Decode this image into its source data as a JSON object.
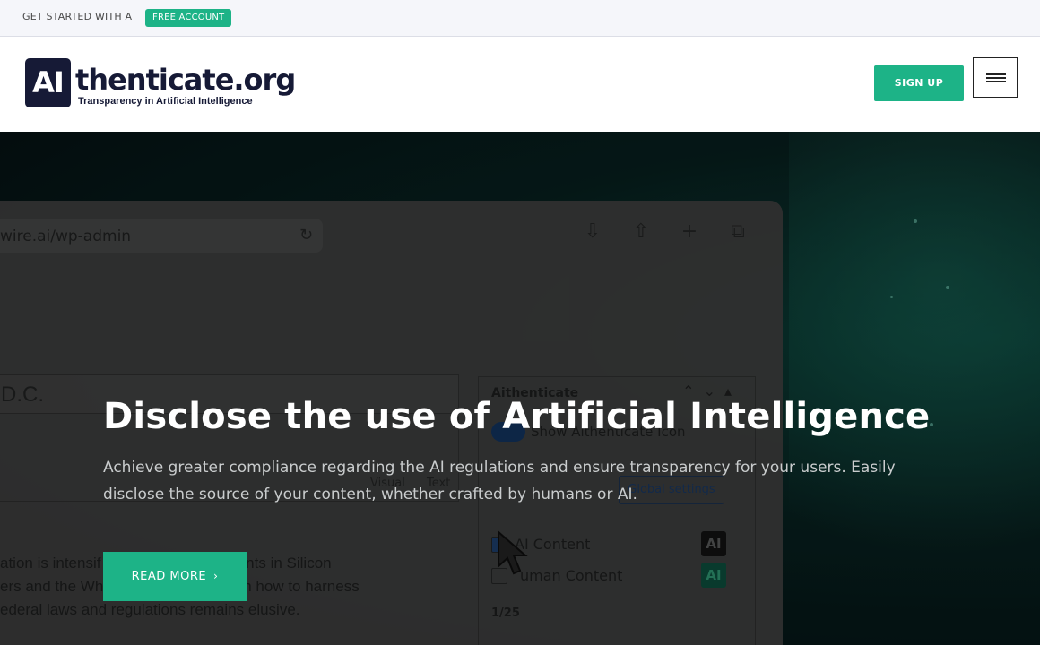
{
  "topbar": {
    "text": "GET STARTED WITH A",
    "badge": "FREE ACCOUNT"
  },
  "header": {
    "logo_mark": "AI",
    "logo_word": "thenticate.org",
    "logo_tagline": "Transparency in Artificial Intelligence",
    "signup_label": "SIGN UP",
    "menu_icon": "hamburger-icon"
  },
  "mockup": {
    "url": "wire.ai/wp-admin",
    "post_title": "D.C.",
    "tab_visual": "Visual",
    "tab_text": "Text",
    "paragraph": [
      "ation is intensif",
      "g tech giants in Silicon",
      "ers and the Wh",
      "ling with how to harness",
      "ederal laws and regulations remains elusive."
    ],
    "panel_title": "Aithenticate",
    "toggle_label": "Show Aithenticate Icon",
    "settings_button": "Global settings",
    "rows": [
      {
        "label": "AI Content",
        "badge": "AI"
      },
      {
        "label": "uman Content",
        "badge": "AI"
      }
    ],
    "page_indicator": "1/25"
  },
  "hero": {
    "title": "Disclose the use of Artificial Intelligence",
    "subtitle": "Achieve greater compliance regarding the AI regulations and ensure transparency for your users. Easily disclose the source of your content, whether crafted by humans or AI.",
    "cta_label": "READ MORE",
    "cta_icon": "chevron-right-icon"
  },
  "colors": {
    "accent": "#1db387",
    "brand_dark": "#161a36",
    "hero_bg": "#071d1c"
  }
}
